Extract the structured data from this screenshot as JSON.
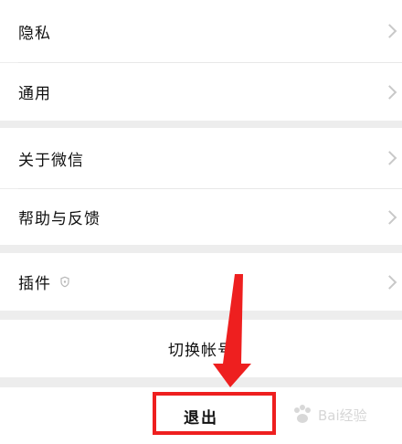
{
  "settings": {
    "items": [
      {
        "label": "隐私",
        "icon": "chevron-right-icon"
      },
      {
        "label": "通用",
        "icon": "chevron-right-icon"
      },
      {
        "label": "关于微信",
        "icon": "chevron-right-icon"
      },
      {
        "label": "帮助与反馈",
        "icon": "chevron-right-icon"
      },
      {
        "label": "插件",
        "icon": "chevron-right-icon",
        "badge_icon": "shield-icon"
      }
    ],
    "switch_account_label": "切换帐号",
    "logout_label": "退出"
  },
  "annotation": {
    "highlight_color": "#ee1f1f",
    "arrow_color": "#ee1f1f"
  },
  "watermark": {
    "text": "Bai经验"
  }
}
